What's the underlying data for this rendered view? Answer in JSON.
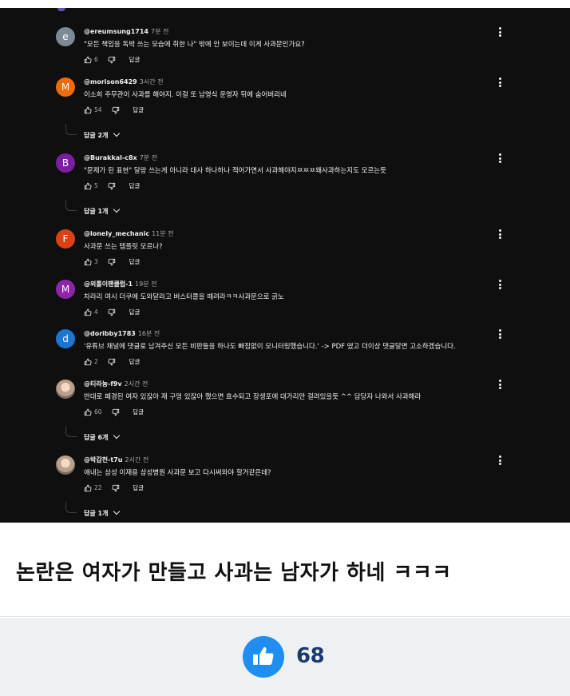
{
  "comments": [
    {
      "avatar_letter": "e",
      "avatar_color": "#7d8a96",
      "handle": "@ereumsung1714",
      "time": "7분 전",
      "text": "\"모든 책임을 독박 쓰는 모습에 취한 나\" 밖에 안 보이는데 이게 사과문인가요?",
      "likes": "6",
      "reply_label": "답글"
    },
    {
      "avatar_letter": "M",
      "avatar_color": "#ef6c00",
      "handle": "@morison6429",
      "time": "3시간 전",
      "text": "이소희 주무관이 사과를 해야지. 이걸 또 남영식 운영자 뒤에 숨어버리네",
      "likes": "54",
      "reply_label": "답글",
      "replies": "답글 2개"
    },
    {
      "avatar_letter": "B",
      "avatar_color": "#7b1fa2",
      "handle": "@Burakkal-c8x",
      "time": "7분 전",
      "text": "\"문제가 된 표현\" 달랑 쓰는게 아니라 대사 하나하나 적어가면서 사과해야지ㅉㅉㅉ왜사과하는지도 모르는듯",
      "likes": "5",
      "reply_label": "답글",
      "replies": "답글 1개"
    },
    {
      "avatar_letter": "F",
      "avatar_color": "#d84315",
      "handle": "@lonely_mechanic",
      "time": "11분 전",
      "text": "사과문 쓰는 템플릿 모르나?",
      "likes": "3",
      "reply_label": "답글"
    },
    {
      "avatar_letter": "M",
      "avatar_color": "#8e24aa",
      "handle": "@외톨이팬클럽-1",
      "time": "19분 전",
      "text": "차라리 여시 더쿠에 도와달라고 버스터콜을 때려라ㅋㅋ사과문으로 긁노",
      "likes": "4",
      "reply_label": "답글"
    },
    {
      "avatar_letter": "d",
      "avatar_color": "#1976d2",
      "handle": "@doribby1783",
      "time": "16분 전",
      "text": "'유튜브 채널에 댓글로 남겨주신 모든 비판들을 하나도 빠짐없이 모니터링했습니다.' -> PDF 떴고 더이상 댓글달면 고소하겠습니다.",
      "likes": "2",
      "reply_label": "답글"
    },
    {
      "avatar_letter": "",
      "avatar_color": "#9e8d82",
      "handle": "@티라농-f9v",
      "time": "2시간 전",
      "text": "반대로 페경된 여자 있잖아 재 구멍 있잖아 했으면 효수되고 장생포에 대가리만 걸려있을듯 ^^ 담당자 나와서 사과해라",
      "likes": "60",
      "reply_label": "답글",
      "replies": "답글 6개"
    },
    {
      "avatar_letter": "",
      "avatar_color": "#9e8d82",
      "handle": "@박갑천-t7u",
      "time": "2시간 전",
      "text": "애내는 삼성 이재용 삼성병원 사과문 보고 다시써와야 할거같은데?",
      "likes": "22",
      "reply_label": "답글",
      "replies": "답글 1개"
    }
  ],
  "caption": "논란은 여자가 만들고 사과는 남자가 하네 ㅋㅋㅋ",
  "like_count": "68",
  "colors": {
    "panel_bg": "#0f0f0f",
    "like_blue": "#1e8ef0",
    "count_navy": "#1a3a6e"
  }
}
